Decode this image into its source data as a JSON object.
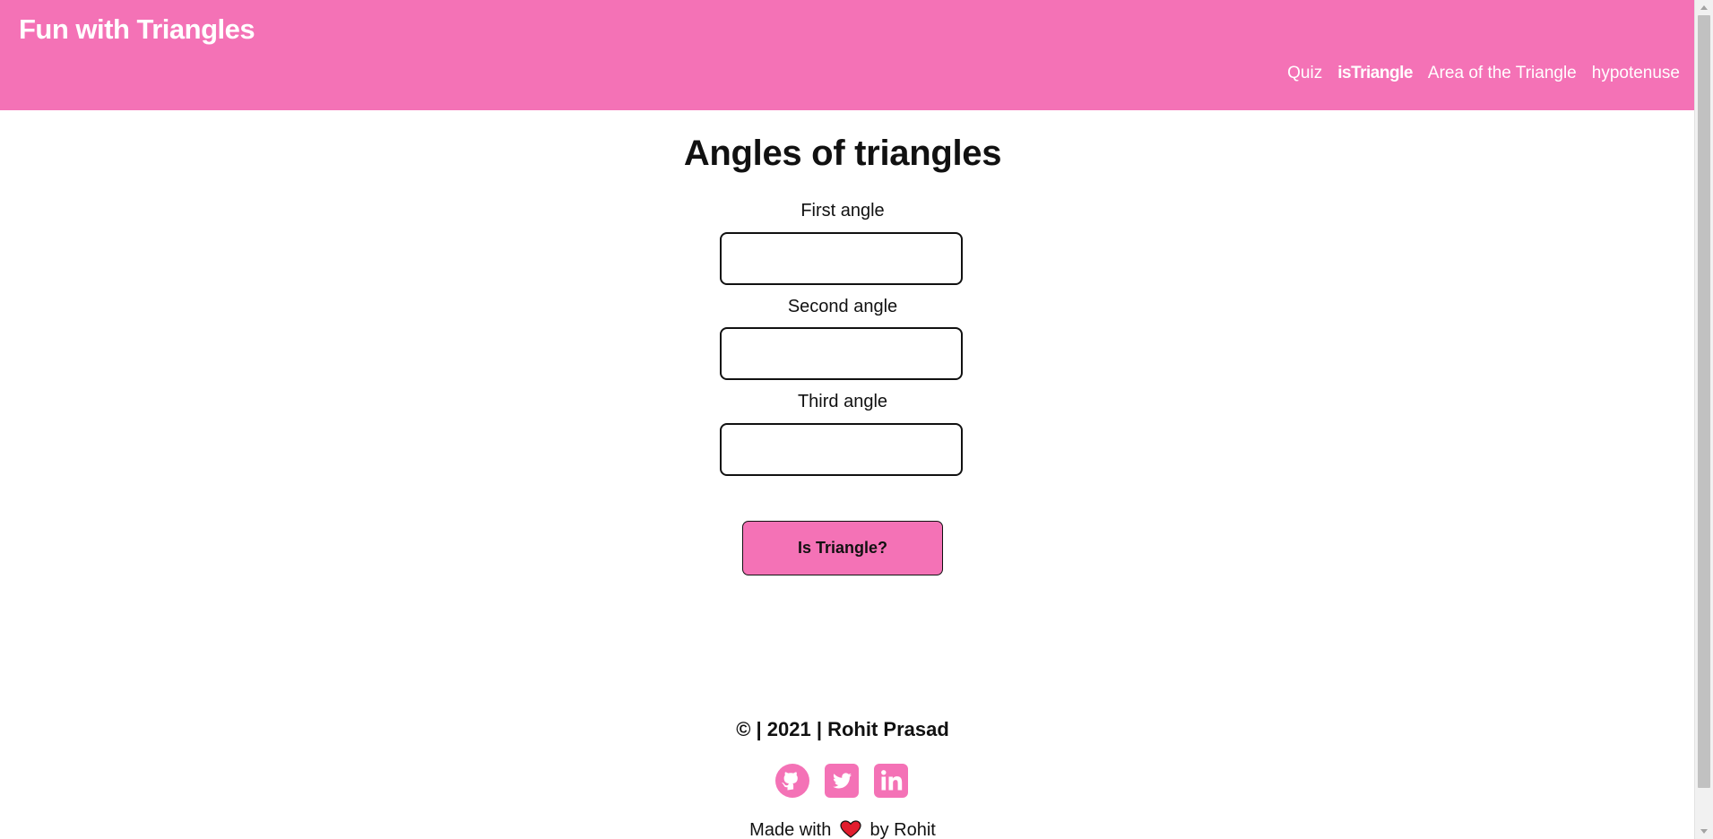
{
  "header": {
    "brand": "Fun with Triangles",
    "nav": [
      {
        "label": "Quiz",
        "active": false
      },
      {
        "label": "isTriangle",
        "active": true
      },
      {
        "label": "Area of the Triangle",
        "active": false
      },
      {
        "label": "hypotenuse",
        "active": false
      }
    ]
  },
  "main": {
    "title": "Angles of triangles",
    "fields": [
      {
        "label": "First angle",
        "value": ""
      },
      {
        "label": "Second angle",
        "value": ""
      },
      {
        "label": "Third angle",
        "value": ""
      }
    ],
    "submit_label": "Is Triangle?"
  },
  "footer": {
    "copyright": "© | 2021 | Rohit Prasad",
    "social_icons": [
      "github-icon",
      "twitter-icon",
      "linkedin-icon"
    ],
    "made_with_prefix": "Made with",
    "made_with_suffix": "by Rohit"
  },
  "colors": {
    "brand_pink": "#f472b6",
    "heart_red": "#e11d2e",
    "text": "#111111"
  }
}
